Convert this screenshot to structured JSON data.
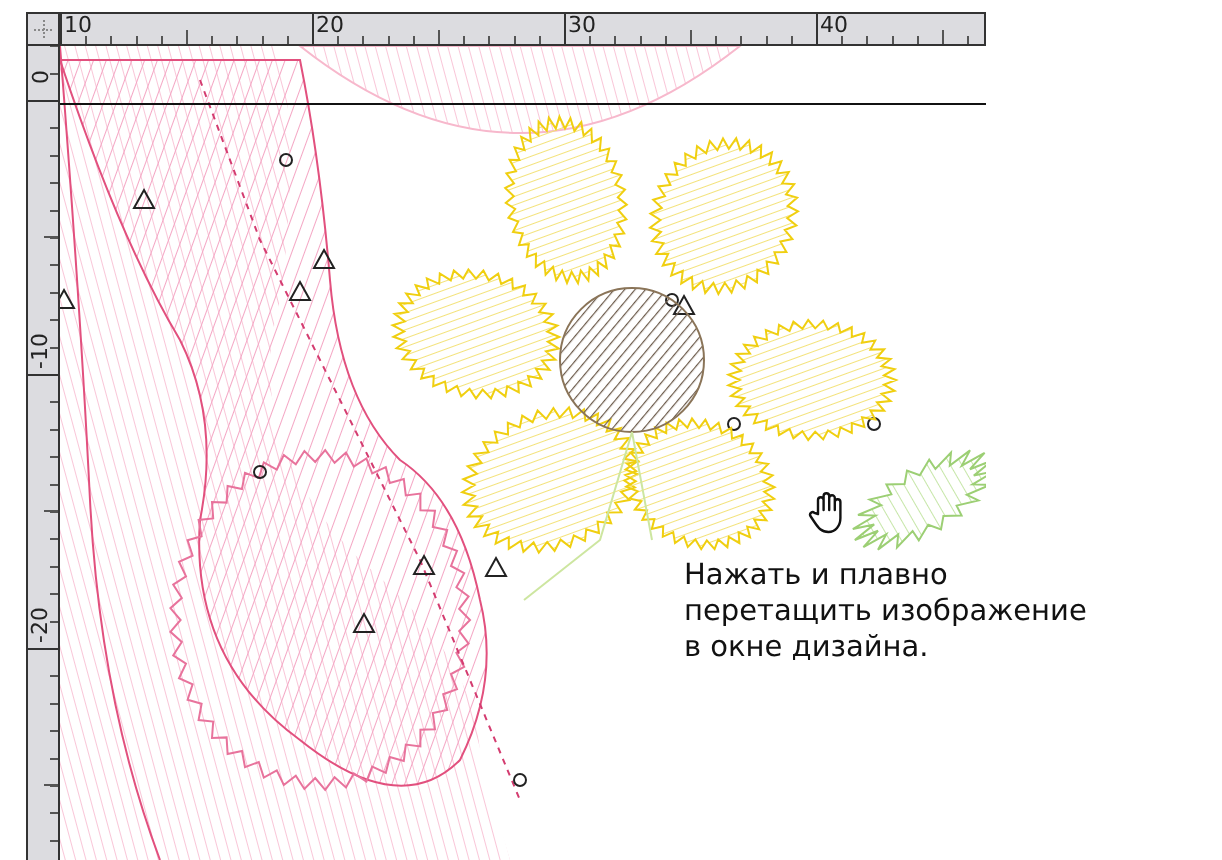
{
  "top_ruler": {
    "labels": [
      "10",
      "20",
      "30",
      "40"
    ]
  },
  "left_ruler": {
    "labels": [
      "0",
      "-10",
      "-20"
    ]
  },
  "hint": {
    "lines": [
      "Нажать и плавно",
      "перетащить изображение",
      "в окне дизайна."
    ]
  }
}
